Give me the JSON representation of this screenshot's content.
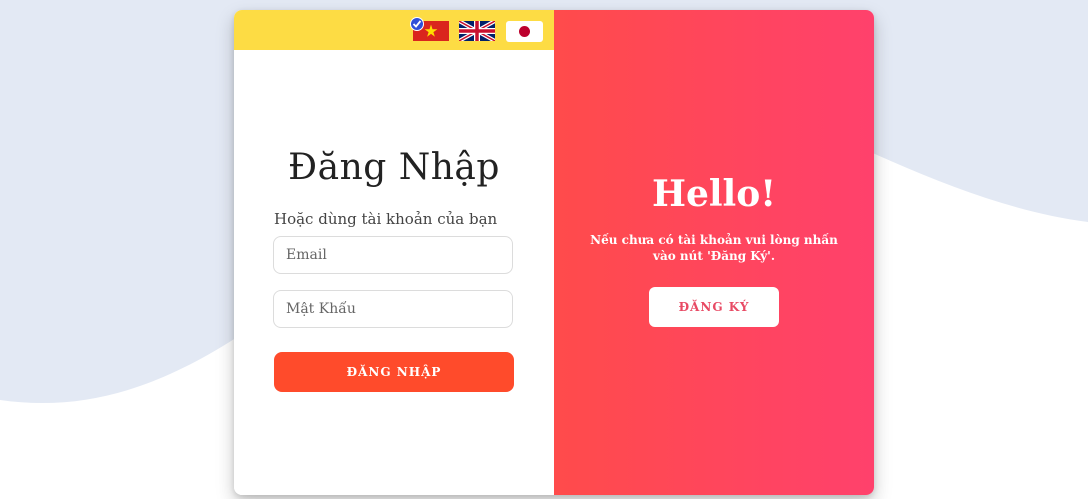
{
  "colors": {
    "background_wave": "#e3e9f4",
    "language_bar": "#fddc44",
    "login_button": "#ff4b2b",
    "panel_gradient_start": "#ff4b4b",
    "panel_gradient_end": "#ff416c"
  },
  "languages": [
    {
      "name": "vietnamese-flag-icon",
      "selected": true
    },
    {
      "name": "uk-flag-icon",
      "selected": false
    },
    {
      "name": "japan-flag-icon",
      "selected": false
    }
  ],
  "login": {
    "title": "Đăng Nhập",
    "subtitle": "Hoặc dùng tài khoản của bạn",
    "email_placeholder": "Email",
    "email_value": "",
    "password_placeholder": "Mật Khẩu",
    "password_value": "",
    "submit_label": "ĐĂNG NHẬP"
  },
  "signup_panel": {
    "heading": "Hello!",
    "message": "Nếu chưa có tài khoản vui lòng nhấn vào nút 'Đăng Ký'.",
    "button_label": "ĐĂNG KÝ"
  }
}
